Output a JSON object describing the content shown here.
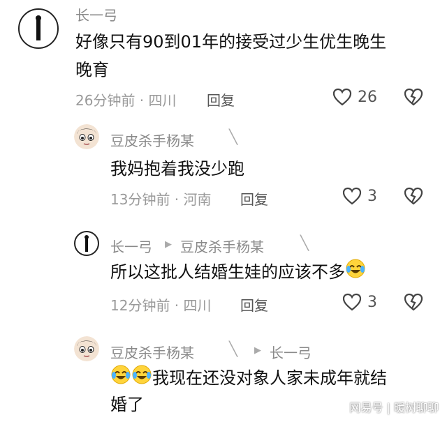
{
  "comments": [
    {
      "user": "长一弓",
      "text_line1": "好像只有90到01年的接受过少生优生晚生",
      "text_line2": "晚育",
      "meta": "26分钟前 · 四川",
      "reply_label": "回复",
      "likes": "26"
    },
    {
      "user": "豆皮杀手杨某",
      "text": "我妈抱着我没少跑",
      "meta": "13分钟前 · 河南",
      "reply_label": "回复",
      "likes": "3"
    },
    {
      "user": "长一弓",
      "reply_to": "豆皮杀手杨某",
      "text": "所以这批人结婚生娃的应该不多",
      "meta": "12分钟前 · 四川",
      "reply_label": "回复",
      "likes": "3"
    },
    {
      "user": "豆皮杀手杨某",
      "reply_to": "长一弓",
      "text_line1": "我现在还没对象人家未成年就结",
      "text_line2": "婚了"
    }
  ],
  "watermark": "网易号 | 暖树聊聊",
  "colors": {
    "text": "#111111",
    "meta": "#9a9a9a",
    "name": "#8a8a8a"
  },
  "icons": [
    "heart-outline-icon",
    "broken-heart-icon",
    "laughing-crying-emoji",
    "reply-arrow-icon"
  ]
}
